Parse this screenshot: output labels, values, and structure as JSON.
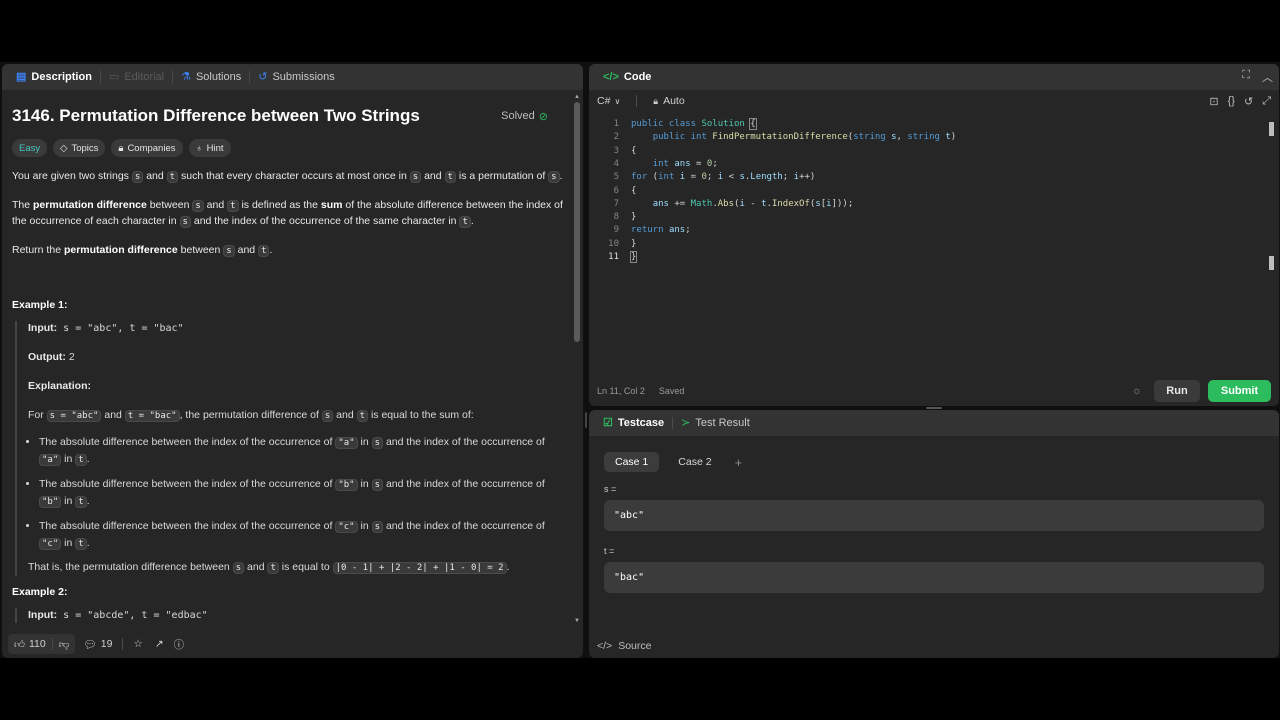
{
  "left_tabs": [
    {
      "label": "Description",
      "icon": "description-icon",
      "state": "active"
    },
    {
      "label": "Editorial",
      "icon": "editorial-icon",
      "state": "disabled"
    },
    {
      "label": "Solutions",
      "icon": "flask-icon",
      "state": "normal"
    },
    {
      "label": "Submissions",
      "icon": "history-icon",
      "state": "normal"
    }
  ],
  "problem": {
    "title": "3146. Permutation Difference between Two Strings",
    "solved": "Solved",
    "difficulty": "Easy",
    "chips": [
      "Topics",
      "Companies",
      "Hint"
    ],
    "p1": {
      "a": "You are given two strings ",
      "s": "s",
      "b": " and ",
      "t": "t",
      "c": " such that every character occurs at most once in ",
      "s2": "s",
      "d": " and ",
      "t2": "t",
      "e": " is a permutation of ",
      "s3": "s",
      "f": "."
    },
    "p2": {
      "a": "The ",
      "b": "permutation difference",
      "c": " between ",
      "s": "s",
      "d": " and ",
      "t": "t",
      "e": " is defined as the ",
      "f": "sum",
      "g": " of the absolute difference between the index of the occurrence of each character in ",
      "s2": "s",
      "h": " and the index of the occurrence of the same character in ",
      "t2": "t",
      "i": "."
    },
    "p3": {
      "a": "Return the ",
      "b": "permutation difference",
      "c": " between ",
      "s": "s",
      "d": " and ",
      "t": "t",
      "e": "."
    },
    "ex1": {
      "title": "Example 1:",
      "input_label": "Input:",
      "input": " s = \"abc\", t = \"bac\"",
      "output_label": "Output:",
      "output": " 2",
      "expl_label": "Explanation:",
      "for_a": "For ",
      "for_s": "s = \"abc\"",
      "for_b": " and ",
      "for_t": "t = \"bac\"",
      "for_c": ", the permutation difference of ",
      "for_s2": "s",
      "for_d": " and ",
      "for_t2": "t",
      "for_e": " is equal to the sum of:",
      "bullets": [
        {
          "a": "The absolute difference between the index of the occurrence of ",
          "ch": "\"a\"",
          "b": " in ",
          "s": "s",
          "c": " and the index of the occurrence of ",
          "ch2": "\"a\"",
          "d": " in ",
          "t": "t",
          "e": "."
        },
        {
          "a": "The absolute difference between the index of the occurrence of ",
          "ch": "\"b\"",
          "b": " in ",
          "s": "s",
          "c": " and the index of the occurrence of ",
          "ch2": "\"b\"",
          "d": " in ",
          "t": "t",
          "e": "."
        },
        {
          "a": "The absolute difference between the index of the occurrence of ",
          "ch": "\"c\"",
          "b": " in ",
          "s": "s",
          "c": " and the index of the occurrence of ",
          "ch2": "\"c\"",
          "d": " in ",
          "t": "t",
          "e": "."
        }
      ],
      "that_a": "That is, the permutation difference between ",
      "that_s": "s",
      "that_b": " and ",
      "that_t": "t",
      "that_c": " is equal to ",
      "that_formula": "|0 - 1| + |2 - 2| + |1 - 0| = 2",
      "that_d": "."
    },
    "ex2": {
      "title": "Example 2:",
      "input_label": "Input:",
      "input": " s = \"abcde\", t = \"edbac\""
    }
  },
  "bottom_bar": {
    "likes": "110",
    "comments": "19"
  },
  "code_panel": {
    "title": "Code",
    "language": "C#",
    "mode": "Auto",
    "status": "Ln 11, Col 2",
    "saved": "Saved",
    "run": "Run",
    "submit": "Submit",
    "line_numbers": [
      "1",
      "2",
      "3",
      "4",
      "5",
      "6",
      "7",
      "8",
      "9",
      "10",
      "11"
    ]
  },
  "testcase_panel": {
    "tab1": "Testcase",
    "tab2": "Test Result",
    "cases": [
      "Case 1",
      "Case 2"
    ],
    "add": "+",
    "s_label": "s =",
    "s_value": "\"abc\"",
    "t_label": "t =",
    "t_value": "\"bac\"",
    "source": "Source"
  },
  "colors": {
    "accent_green": "#2cbb5d",
    "easy": "#46c6c2",
    "blue": "#3b82f6"
  }
}
